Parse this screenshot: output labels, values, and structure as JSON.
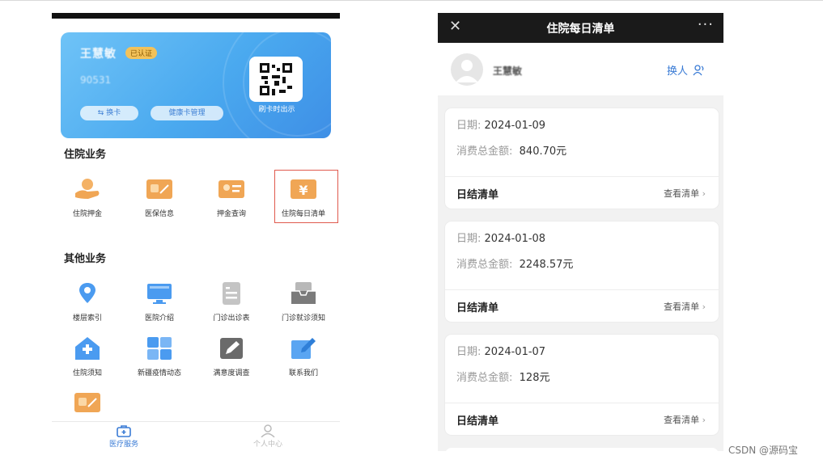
{
  "left_phone": {
    "card": {
      "name": "王慧敏",
      "verified_badge": "已认证",
      "card_number": "90531",
      "switch_card_label": "换卡",
      "manage_label": "健康卡管理",
      "qr_caption": "刷卡时出示"
    },
    "sections": [
      {
        "title": "住院业务",
        "items": [
          {
            "label": "住院押金",
            "icon": "deposit-hand-icon",
            "color": "#f0a655"
          },
          {
            "label": "医保信息",
            "icon": "insurance-card-icon",
            "color": "#f0a655"
          },
          {
            "label": "押金查询",
            "icon": "id-card-icon",
            "color": "#f0a655"
          },
          {
            "label": "住院每日清单",
            "icon": "yuan-bill-icon",
            "color": "#f0a655",
            "highlighted": true
          }
        ]
      },
      {
        "title": "其他业务",
        "items": [
          {
            "label": "楼层索引",
            "icon": "map-pin-icon",
            "color": "#4b9bf0"
          },
          {
            "label": "医院介绍",
            "icon": "monitor-icon",
            "color": "#4b9bf0"
          },
          {
            "label": "门诊出诊表",
            "icon": "schedule-list-icon",
            "color": "#b5b5b5"
          },
          {
            "label": "门诊就诊须知",
            "icon": "inbox-icon",
            "color": "#8a8a8a"
          },
          {
            "label": "住院须知",
            "icon": "hospital-home-icon",
            "color": "#4b9bf0"
          },
          {
            "label": "新疆疫情动态",
            "icon": "tiles-icon",
            "color": "#4b9bf0"
          },
          {
            "label": "满意度调查",
            "icon": "edit-survey-icon",
            "color": "#6a6a6a"
          },
          {
            "label": "联系我们",
            "icon": "note-pencil-icon",
            "color": "#4b9bf0"
          }
        ]
      }
    ],
    "tabbar": [
      {
        "label": "医疗服务",
        "icon": "medical-kit-icon",
        "active": true
      },
      {
        "label": "个人中心",
        "icon": "person-icon",
        "active": false
      }
    ]
  },
  "right_phone": {
    "title": "住院每日清单",
    "user_name": "王慧敏",
    "switch_user_label": "换人",
    "bills": [
      {
        "date_key": "日期:",
        "date": "2024-01-09",
        "total_key": "消费总金额:",
        "total": "840.70元",
        "footer_label": "日结清单",
        "link": "查看清单"
      },
      {
        "date_key": "日期:",
        "date": "2024-01-08",
        "total_key": "消费总金额:",
        "total": "2248.57元",
        "footer_label": "日结清单",
        "link": "查看清单"
      },
      {
        "date_key": "日期:",
        "date": "2024-01-07",
        "total_key": "消费总金额:",
        "total": "128元",
        "footer_label": "日结清单",
        "link": "查看清单"
      }
    ]
  },
  "watermark": "CSDN @源码宝",
  "colors": {
    "accent_blue": "#3a7bd5",
    "highlight_red": "#e05a4e",
    "card_blue": "#4aa9ef"
  }
}
